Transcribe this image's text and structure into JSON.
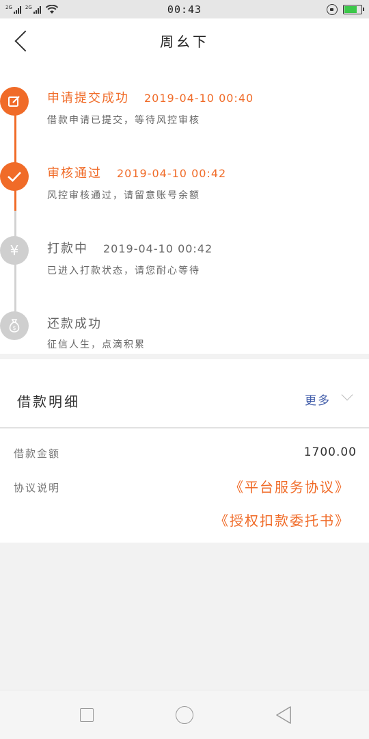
{
  "status_bar": {
    "sim1_label": "2G",
    "sim2_label": "2G",
    "time": "00:43",
    "battery_level": 0.75,
    "battery_color": "#3cc84a"
  },
  "header": {
    "title": "周幺下",
    "back_icon": "chevron-left-icon"
  },
  "timeline": {
    "accent_color": "#f06b28",
    "inactive_color": "#cfcfcf",
    "steps": [
      {
        "title": "申请提交成功",
        "time": "2019-04-10 00:40",
        "desc": "借款申请已提交，等待风控审核",
        "status": "done",
        "icon": "edit-icon"
      },
      {
        "title": "审核通过",
        "time": "2019-04-10 00:42",
        "desc": "风控审核通过，请留意账号余额",
        "status": "done",
        "icon": "check-icon"
      },
      {
        "title": "打款中",
        "time": "2019-04-10 00:42",
        "desc": "已进入打款状态，请您耐心等待",
        "status": "pending",
        "icon": "yen-icon"
      },
      {
        "title": "还款成功",
        "time": "",
        "desc": "征信人生，点滴积累",
        "status": "pending",
        "icon": "money-bag-icon"
      }
    ]
  },
  "detail": {
    "title": "借款明细",
    "more_label": "更多",
    "amount_label": "借款金额",
    "amount_value": "1700.00",
    "agreement_label": "协议说明",
    "agreements": [
      "《平台服务协议》",
      "《授权扣款委托书》"
    ]
  },
  "nav_bar": {
    "recent_icon": "square-icon",
    "home_icon": "circle-icon",
    "back_icon": "triangle-back-icon"
  }
}
